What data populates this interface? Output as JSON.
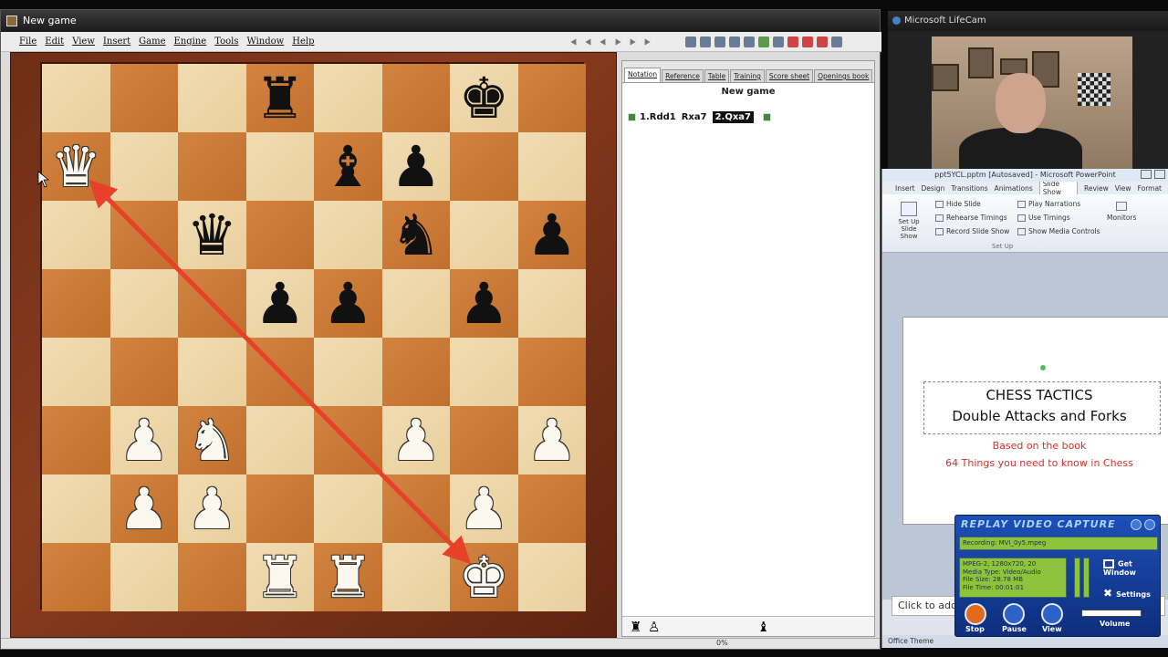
{
  "chess_app": {
    "window_title": "New game",
    "menu": [
      "File",
      "Edit",
      "View",
      "Insert",
      "Game",
      "Engine",
      "Tools",
      "Window",
      "Help"
    ],
    "tabs": [
      "Notation",
      "Reference",
      "Table",
      "Training",
      "Score sheet",
      "Openings book"
    ],
    "game_title": "New game",
    "moves": [
      "1.Rdd1",
      "Rxa7",
      "2.Qxa7"
    ],
    "current_move": "2.Qxa7",
    "status_text": "0%",
    "board": [
      [
        "",
        "",
        "",
        "bR",
        "",
        "",
        "bK",
        ""
      ],
      [
        "wQ",
        "",
        "",
        "",
        "bB",
        "bP",
        "",
        ""
      ],
      [
        "",
        "",
        "bQ",
        "",
        "",
        "bN",
        "",
        "bP"
      ],
      [
        "",
        "",
        "",
        "bP",
        "bP",
        "",
        "bP",
        ""
      ],
      [
        "",
        "",
        "",
        "",
        "",
        "",
        "",
        ""
      ],
      [
        "",
        "wP",
        "wN",
        "",
        "",
        "wP",
        "",
        "wP"
      ],
      [
        "",
        "wP",
        "wP",
        "",
        "",
        "",
        "wP",
        ""
      ],
      [
        "",
        "",
        "",
        "wR",
        "wR",
        "",
        "wK",
        ""
      ]
    ],
    "arrow": {
      "from": "a7",
      "to": "g1",
      "color": "#e8412a"
    }
  },
  "webcam": {
    "window_title": "Microsoft LifeCam"
  },
  "powerpoint": {
    "window_title": "ppt5YCL.pptm [Autosaved] - Microsoft PowerPoint",
    "ribbon_tabs": [
      "Insert",
      "Design",
      "Transitions",
      "Animations",
      "Slide Show",
      "Review",
      "View",
      "Format"
    ],
    "active_tab": "Slide Show",
    "ribbon": {
      "setup_button": "Set Up Slide Show",
      "hide_slide": "Hide Slide",
      "rehearse": "Rehearse Timings",
      "record": "Record Slide Show",
      "play_narrations": "Play Narrations",
      "use_timings": "Use Timings",
      "show_media": "Show Media Controls",
      "monitors": "Monitors",
      "group_label": "Set Up"
    },
    "slide": {
      "title_line1": "CHESS TACTICS",
      "title_line2": "Double Attacks and Forks",
      "subtitle_line1": "Based on the book",
      "subtitle_line2": "64 Things you need to know in Chess"
    },
    "notes_placeholder": "Click to add n",
    "status": "Office Theme"
  },
  "replay_capture": {
    "title": "REPLAY VIDEO CAPTURE",
    "filename": "Recording: MVI_0y5.mpeg",
    "info_lines": [
      "MPEG-2, 1280x720, 20",
      "Media Type: Video/Audio",
      "File Size: 28.78 MB",
      "File Time: 00:01:01"
    ],
    "get_window_label": "Get Window",
    "settings_label": "Settings",
    "buttons": [
      "Stop",
      "Pause",
      "View"
    ],
    "volume_label": "Volume"
  }
}
